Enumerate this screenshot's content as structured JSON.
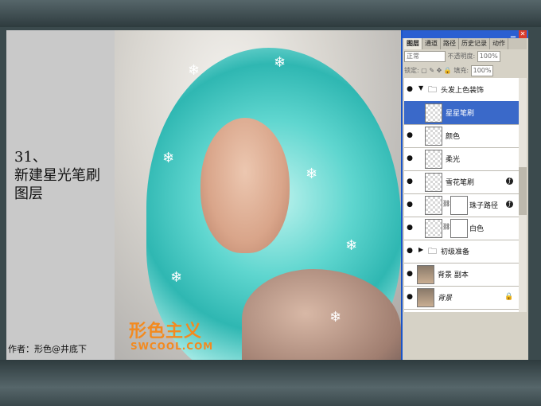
{
  "step": {
    "title": "31、\n新建星光笔刷\n图层"
  },
  "author": "作者：形色@井底下",
  "watermark": {
    "logo_cn": "形色主义",
    "logo_en": "SWCOOL.COM"
  },
  "panel": {
    "tabs": [
      {
        "label": "图层",
        "active": true
      },
      {
        "label": "通道",
        "active": false
      },
      {
        "label": "路径",
        "active": false
      },
      {
        "label": "历史记录",
        "active": false
      },
      {
        "label": "动作",
        "active": false
      }
    ],
    "blend_mode": "正常",
    "opacity_label": "不透明度:",
    "opacity_value": "100%",
    "lock_label": "锁定:",
    "fill_label": "填充:",
    "fill_value": "100%",
    "layers": [
      {
        "name": "头发上色装饰",
        "type": "group-open",
        "visible": true
      },
      {
        "name": "星星笔刷",
        "type": "layer",
        "selected": true,
        "visible": false
      },
      {
        "name": "颜色",
        "type": "layer",
        "visible": true
      },
      {
        "name": "柔光",
        "type": "layer",
        "visible": true
      },
      {
        "name": "雪花笔刷",
        "type": "layer-fx",
        "visible": true
      },
      {
        "name": "珠子路径",
        "type": "layer-mask-fx",
        "visible": true
      },
      {
        "name": "白色",
        "type": "layer-mask",
        "visible": true
      },
      {
        "name": "初级准备",
        "type": "group-closed",
        "visible": true
      },
      {
        "name": "背景 副本",
        "type": "photo",
        "visible": true
      },
      {
        "name": "背景",
        "type": "photo-locked",
        "visible": true
      }
    ]
  },
  "colors": {
    "highlight": "#3a69c9",
    "hair": "#5fd6cf",
    "logo": "#f38a1f"
  }
}
